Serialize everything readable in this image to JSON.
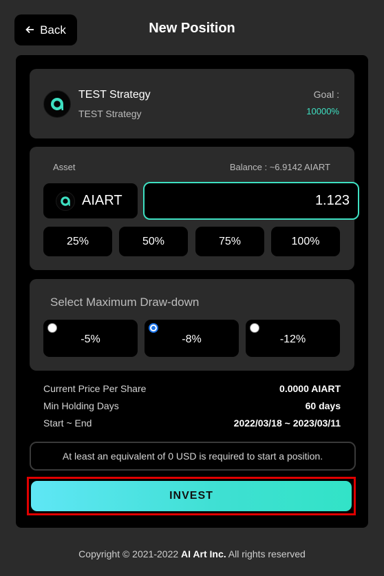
{
  "header": {
    "back_label": "Back",
    "title": "New Position"
  },
  "strategy": {
    "name": "TEST Strategy",
    "subtitle": "TEST Strategy",
    "goal_label": "Goal :",
    "goal_value": "10000%",
    "logo_icon": "aiart-logo-icon"
  },
  "asset": {
    "label": "Asset",
    "balance": "Balance : ~6.9142 AIART",
    "token": "AIART",
    "amount": "1.123",
    "percent_buttons": [
      "25%",
      "50%",
      "75%",
      "100%"
    ]
  },
  "drawdown": {
    "title": "Select Maximum Draw-down",
    "options": [
      "-5%",
      "-8%",
      "-12%"
    ],
    "selected": "-8%"
  },
  "info": {
    "price_label": "Current Price Per Share",
    "price_value": "0.0000 AIART",
    "holding_label": "Min Holding Days",
    "holding_value": "60 days",
    "period_label": "Start ~ End",
    "period_value": "2022/03/18 ~ 2023/03/11"
  },
  "notice": "At least an equivalent of 0 USD is required to start a position.",
  "invest_label": "INVEST",
  "footer": {
    "prefix": "Copyright © 2021-2022 ",
    "company": "AI Art Inc.",
    "suffix": " All rights reserved"
  },
  "colors": {
    "accent": "#3ee0c2",
    "background": "#2b2b2b",
    "panel": "#000000"
  }
}
